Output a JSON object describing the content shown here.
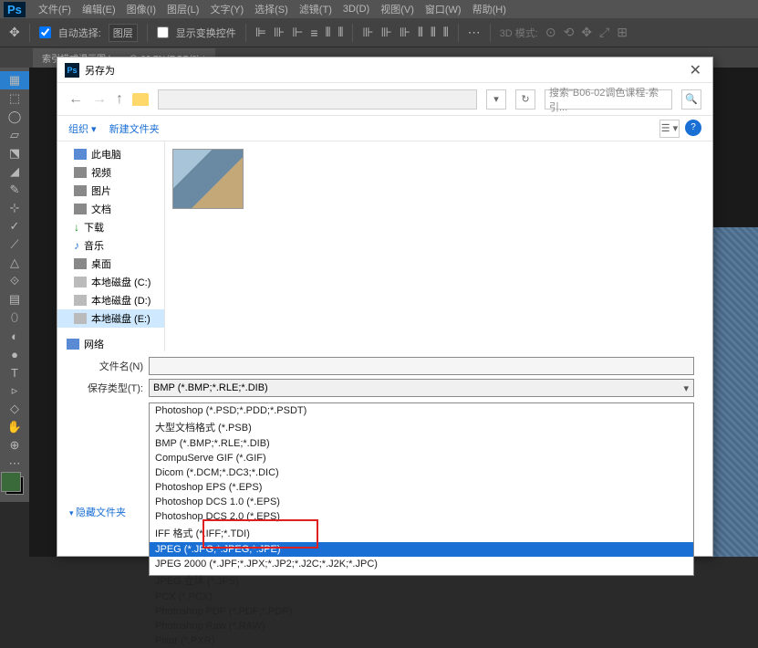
{
  "menubar": [
    "文件(F)",
    "编辑(E)",
    "图像(I)",
    "图层(L)",
    "文字(Y)",
    "选择(S)",
    "滤镜(T)",
    "3D(D)",
    "视图(V)",
    "窗口(W)",
    "帮助(H)"
  ],
  "optbar": {
    "auto_select": "自动选择:",
    "layer_sel": "图层",
    "show_transform": "显示变换控件",
    "mode_3d": "3D 模式:"
  },
  "doc_tab": "索引模式漫画图.bmp @ 66.7%(RGB/8) *",
  "dialog": {
    "title": "另存为",
    "search_placeholder": "搜索\"B06-02调色课程-索引...",
    "organize": "组织",
    "new_folder": "新建文件夹",
    "tree": [
      {
        "label": "此电脑",
        "icon": "pc"
      },
      {
        "label": "视频",
        "icon": "gen"
      },
      {
        "label": "图片",
        "icon": "gen"
      },
      {
        "label": "文档",
        "icon": "gen"
      },
      {
        "label": "下载",
        "icon": "dl"
      },
      {
        "label": "音乐",
        "icon": "mus"
      },
      {
        "label": "桌面",
        "icon": "gen"
      },
      {
        "label": "本地磁盘 (C:)",
        "icon": "disk"
      },
      {
        "label": "本地磁盘 (D:)",
        "icon": "disk"
      },
      {
        "label": "本地磁盘 (E:)",
        "icon": "disk",
        "selected": true
      },
      {
        "label": "网络",
        "icon": "net"
      }
    ],
    "filename_label": "文件名(N)",
    "filetype_label": "保存类型(T):",
    "filetype_value": "BMP (*.BMP;*.RLE;*.DIB)",
    "hide_folders": "隐藏文件夹",
    "type_options": [
      "Photoshop (*.PSD;*.PDD;*.PSDT)",
      "大型文档格式 (*.PSB)",
      "BMP (*.BMP;*.RLE;*.DIB)",
      "CompuServe GIF (*.GIF)",
      "Dicom (*.DCM;*.DC3;*.DIC)",
      "Photoshop EPS (*.EPS)",
      "Photoshop DCS 1.0 (*.EPS)",
      "Photoshop DCS 2.0 (*.EPS)",
      "IFF 格式 (*.IFF;*.TDI)",
      "JPEG (*.JPG;*.JPEG;*.JPE)",
      "JPEG 2000 (*.JPF;*.JPX;*.JP2;*.J2C;*.J2K;*.JPC)",
      "JPEG 立体 (*.JPS)",
      "PCX (*.PCX)",
      "Photoshop PDF (*.PDF;*.PDP)",
      "Photoshop Raw (*.RAW)",
      "Pixar (*.PXR)"
    ],
    "highlighted_option": 9
  },
  "tools": [
    "▦",
    "⬚",
    "◯",
    "▱",
    "⬔",
    "◢",
    "✎",
    "⊹",
    "✓",
    "⟋",
    "△",
    "⟐",
    "▤",
    "⬯",
    "◐",
    "●",
    "T",
    "▹",
    "◇",
    "✋",
    "⊕",
    "⋯"
  ]
}
